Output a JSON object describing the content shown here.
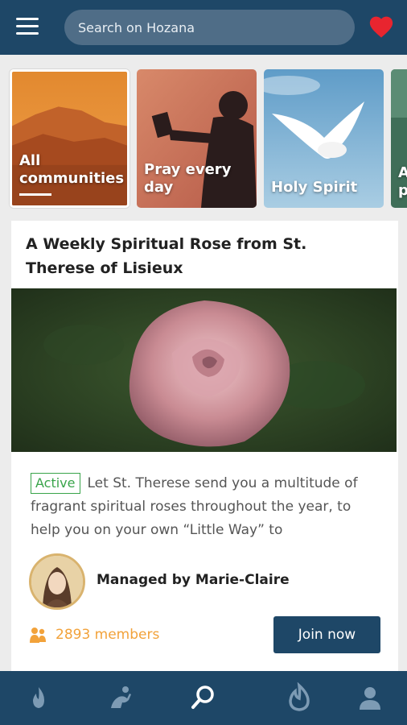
{
  "header": {
    "search_placeholder": "Search on Hozana",
    "heart_color": "#e8252f",
    "bg_color": "#1e4767"
  },
  "categories": [
    {
      "label_lines": [
        "All",
        "communities"
      ],
      "selected": true,
      "image": "mountain-sunset"
    },
    {
      "label_lines": [
        "Pray every",
        "day"
      ],
      "selected": false,
      "image": "man-praying-silhouette"
    },
    {
      "label_lines": [
        "Holy Spirit"
      ],
      "selected": false,
      "image": "white-dove-sky"
    },
    {
      "label_lines": [
        "A",
        "p"
      ],
      "selected": false,
      "image": "green-partial"
    }
  ],
  "card": {
    "title": "A Weekly Spiritual Rose from St. Therese of Lisieux",
    "image": "pink-rose",
    "status_badge": "Active",
    "description": "Let St. Therese send you a multitude of fragrant spiritual roses throughout the year, to help you on your own “Little Way” to",
    "manager_name": "Managed by Marie-Claire",
    "members": "2893 members",
    "join_label": "Join now"
  },
  "bottom_nav": [
    {
      "name": "flame-icon",
      "active": false
    },
    {
      "name": "praying-person-icon",
      "active": false
    },
    {
      "name": "search-icon",
      "active": true
    },
    {
      "name": "community-flame-icon",
      "active": false
    },
    {
      "name": "profile-icon",
      "active": false
    }
  ],
  "colors": {
    "primary": "#1e4767",
    "active_badge": "#39a44a",
    "members": "#f2a23a"
  }
}
